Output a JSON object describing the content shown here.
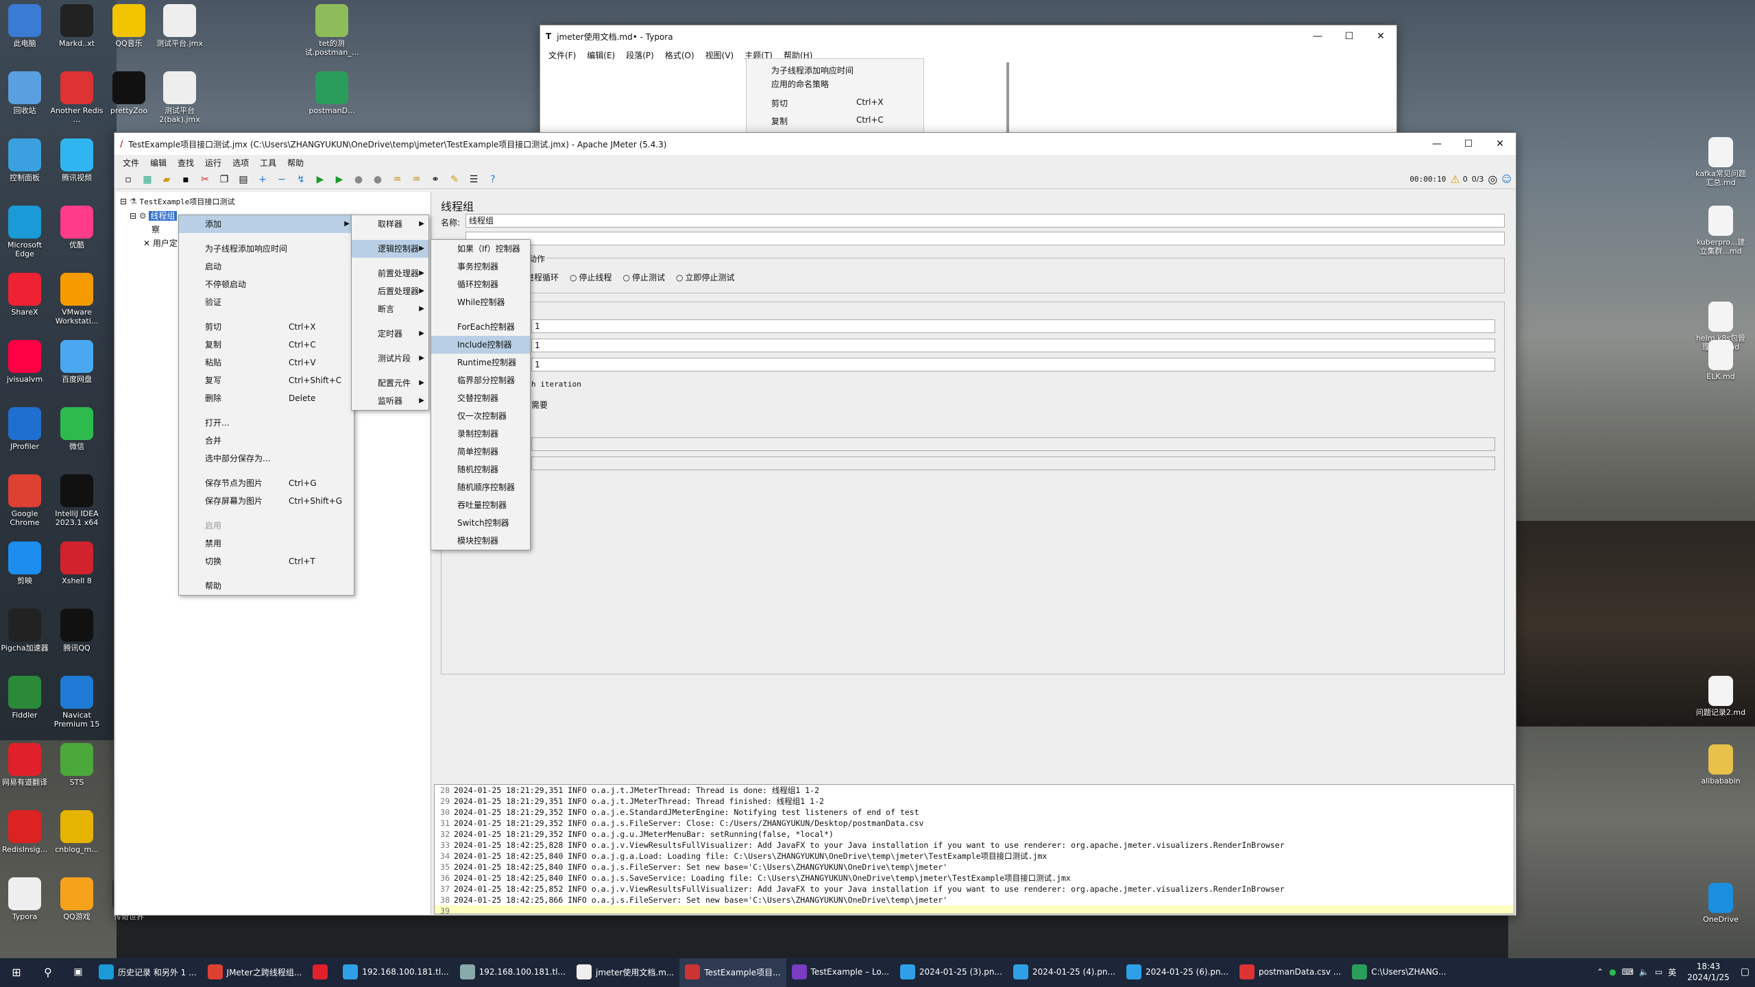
{
  "desktop_icons": [
    {
      "label": "此电脑",
      "color": "#3a7bd5"
    },
    {
      "label": "Markd..xt",
      "color": "#222"
    },
    {
      "label": "QQ音乐",
      "color": "#f2c500"
    },
    {
      "label": "测试平台.jmx",
      "color": "#eee"
    },
    {
      "label": "tet的测试.postman_...",
      "color": "#8fbc5a"
    },
    {
      "label": "回收站",
      "color": "#5aa0e0"
    },
    {
      "label": "Another Redis ...",
      "color": "#d33"
    },
    {
      "label": "prettyZoo",
      "color": "#111"
    },
    {
      "label": "测试平台 2(bak).jmx",
      "color": "#eee"
    },
    {
      "label": "postmanD...",
      "color": "#2a9d5a"
    },
    {
      "label": "控制面板",
      "color": "#3aa0e0"
    },
    {
      "label": "腾讯视频",
      "color": "#2fb6f0"
    },
    {
      "label": "Microsoft Edge",
      "color": "#1a9bd7"
    },
    {
      "label": "优酷",
      "color": "#ff3b8a"
    },
    {
      "label": "ShareX",
      "color": "#e23"
    },
    {
      "label": "VMware Workstati...",
      "color": "#f59b00"
    },
    {
      "label": "jvisualvm",
      "color": "#f04"
    },
    {
      "label": "百度网盘",
      "color": "#4aa8f0"
    },
    {
      "label": "JProfiler",
      "color": "#1f6fd0"
    },
    {
      "label": "微信",
      "color": "#2dbb4e"
    },
    {
      "label": "Google Chrome",
      "color": "#de4032"
    },
    {
      "label": "IntelliJ IDEA 2023.1 x64",
      "color": "#111"
    },
    {
      "label": "剪映",
      "color": "#1b8ef0"
    },
    {
      "label": "Xshell 8",
      "color": "#d2222d"
    },
    {
      "label": "Pigcha加速器",
      "color": "#222"
    },
    {
      "label": "腾讯QQ",
      "color": "#111"
    },
    {
      "label": "Fiddler",
      "color": "#2a8a3a"
    },
    {
      "label": "Navicat Premium 15",
      "color": "#1f7bd5"
    },
    {
      "label": "网易有道翻译",
      "color": "#e0202a"
    },
    {
      "label": "STS",
      "color": "#4ba83a"
    },
    {
      "label": "RedisInsig...",
      "color": "#d22"
    },
    {
      "label": "cnblog_m...",
      "color": "#e5b400"
    },
    {
      "label": "Typora",
      "color": "#eee"
    },
    {
      "label": "QQ游戏",
      "color": "#f7a21b"
    },
    {
      "label": "传奇世界",
      "color": "#333"
    }
  ],
  "right_icons": [
    {
      "label": "kafka常见问题汇总.md"
    },
    {
      "label": "kuberpro...建立集群...md"
    },
    {
      "label": "helm k8s包管理工具.md"
    },
    {
      "label": "ELK.md"
    },
    {
      "label": "问题记录2.md"
    },
    {
      "label": "alibababin"
    },
    {
      "label": "OneDrive"
    }
  ],
  "typora": {
    "title": "jmeter使用文档.md• - Typora",
    "menus": [
      "文件(F)",
      "编辑(E)",
      "段落(P)",
      "格式(O)",
      "视图(V)",
      "主题(T)",
      "帮助(H)"
    ],
    "peek_items": [
      "为子线程添加响应时间",
      "应用的命名策略",
      "剪切",
      "复制"
    ],
    "peek_shortcuts": [
      "",
      "",
      "Ctrl+X",
      "Ctrl+C"
    ]
  },
  "jmeter": {
    "title": "TestExample项目接口测试.jmx (C:\\Users\\ZHANGYUKUN\\OneDrive\\temp\\jmeter\\TestExample项目接口测试.jmx) - Apache JMeter (5.4.3)",
    "menus": [
      "文件",
      "编辑",
      "查找",
      "运行",
      "选项",
      "工具",
      "帮助"
    ],
    "timer": "00:00:10",
    "warn_count": "0",
    "threads": "0/3",
    "tree": {
      "root": "TestExample项目接口测试",
      "thread_group": "线程组",
      "child1": "察",
      "child2": "用户定"
    },
    "panel": {
      "heading": "线程组",
      "name_label": "名称:",
      "name_value": "线程组",
      "action_label": "的动作",
      "radios": [
        "进程循环",
        "停止线程",
        "停止测试",
        "立即停止测试"
      ],
      "values": [
        "1",
        "1",
        "1"
      ],
      "iteration_text": "h iteration",
      "needed_text": "需要"
    },
    "log": [
      {
        "n": "28",
        "t": "2024-01-25 18:21:29,351 INFO o.a.j.t.JMeterThread: Thread is done: 线程组1 1-2"
      },
      {
        "n": "29",
        "t": "2024-01-25 18:21:29,351 INFO o.a.j.t.JMeterThread: Thread finished: 线程组1 1-2"
      },
      {
        "n": "30",
        "t": "2024-01-25 18:21:29,352 INFO o.a.j.e.StandardJMeterEngine: Notifying test listeners of end of test"
      },
      {
        "n": "31",
        "t": "2024-01-25 18:21:29,352 INFO o.a.j.s.FileServer: Close: C:/Users/ZHANGYUKUN/Desktop/postmanData.csv"
      },
      {
        "n": "32",
        "t": "2024-01-25 18:21:29,352 INFO o.a.j.g.u.JMeterMenuBar: setRunning(false, *local*)"
      },
      {
        "n": "33",
        "t": "2024-01-25 18:42:25,828 INFO o.a.j.v.ViewResultsFullVisualizer: Add JavaFX to your Java installation if you want to use renderer: org.apache.jmeter.visualizers.RenderInBrowser"
      },
      {
        "n": "34",
        "t": "2024-01-25 18:42:25,840 INFO o.a.j.g.a.Load: Loading file: C:\\Users\\ZHANGYUKUN\\OneDrive\\temp\\jmeter\\TestExample项目接口测试.jmx"
      },
      {
        "n": "35",
        "t": "2024-01-25 18:42:25,840 INFO o.a.j.s.FileServer: Set new base='C:\\Users\\ZHANGYUKUN\\OneDrive\\temp\\jmeter'"
      },
      {
        "n": "36",
        "t": "2024-01-25 18:42:25,840 INFO o.a.j.s.SaveService: Loading file: C:\\Users\\ZHANGYUKUN\\OneDrive\\temp\\jmeter\\TestExample项目接口测试.jmx"
      },
      {
        "n": "37",
        "t": "2024-01-25 18:42:25,852 INFO o.a.j.v.ViewResultsFullVisualizer: Add JavaFX to your Java installation if you want to use renderer: org.apache.jmeter.visualizers.RenderInBrowser"
      },
      {
        "n": "38",
        "t": "2024-01-25 18:42:25,866 INFO o.a.j.s.FileServer: Set new base='C:\\Users\\ZHANGYUKUN\\OneDrive\\temp\\jmeter'"
      },
      {
        "n": "39",
        "t": ""
      }
    ]
  },
  "context_menu": [
    {
      "label": "添加",
      "shortcut": "",
      "submenu": true,
      "highlight": true
    },
    {
      "sep": true
    },
    {
      "label": "为子线程添加响应时间",
      "shortcut": ""
    },
    {
      "label": "启动",
      "shortcut": ""
    },
    {
      "label": "不停顿启动",
      "shortcut": ""
    },
    {
      "label": "验证",
      "shortcut": ""
    },
    {
      "sep": true
    },
    {
      "label": "剪切",
      "shortcut": "Ctrl+X"
    },
    {
      "label": "复制",
      "shortcut": "Ctrl+C"
    },
    {
      "label": "粘贴",
      "shortcut": "Ctrl+V"
    },
    {
      "label": "复写",
      "shortcut": "Ctrl+Shift+C"
    },
    {
      "label": "删除",
      "shortcut": "Delete"
    },
    {
      "sep": true
    },
    {
      "label": "打开...",
      "shortcut": ""
    },
    {
      "label": "合并",
      "shortcut": ""
    },
    {
      "label": "选中部分保存为...",
      "shortcut": ""
    },
    {
      "sep": true
    },
    {
      "label": "保存节点为图片",
      "shortcut": "Ctrl+G"
    },
    {
      "label": "保存屏幕为图片",
      "shortcut": "Ctrl+Shift+G"
    },
    {
      "sep": true
    },
    {
      "label": "启用",
      "shortcut": "",
      "disabled": true
    },
    {
      "label": "禁用",
      "shortcut": ""
    },
    {
      "label": "切换",
      "shortcut": "Ctrl+T"
    },
    {
      "sep": true
    },
    {
      "label": "帮助",
      "shortcut": ""
    }
  ],
  "add_menu": [
    {
      "label": "取样器",
      "submenu": true
    },
    {
      "sep": true
    },
    {
      "label": "逻辑控制器",
      "submenu": true,
      "highlight": true
    },
    {
      "sep": true
    },
    {
      "label": "前置处理器",
      "submenu": true
    },
    {
      "label": "后置处理器",
      "submenu": true
    },
    {
      "label": "断言",
      "submenu": true
    },
    {
      "sep": true
    },
    {
      "label": "定时器",
      "submenu": true
    },
    {
      "sep": true
    },
    {
      "label": "测试片段",
      "submenu": true
    },
    {
      "sep": true
    },
    {
      "label": "配置元件",
      "submenu": true
    },
    {
      "label": "监听器",
      "submenu": true
    }
  ],
  "logic_menu": [
    {
      "label": "如果（If）控制器"
    },
    {
      "label": "事务控制器"
    },
    {
      "label": "循环控制器"
    },
    {
      "label": "While控制器"
    },
    {
      "sep": true
    },
    {
      "label": "ForEach控制器"
    },
    {
      "label": "Include控制器",
      "highlight": true
    },
    {
      "label": "Runtime控制器"
    },
    {
      "label": "临界部分控制器"
    },
    {
      "label": "交替控制器"
    },
    {
      "label": "仅一次控制器"
    },
    {
      "label": "录制控制器"
    },
    {
      "label": "简单控制器"
    },
    {
      "label": "随机控制器"
    },
    {
      "label": "随机顺序控制器"
    },
    {
      "label": "吞吐量控制器"
    },
    {
      "label": "Switch控制器"
    },
    {
      "label": "模块控制器"
    }
  ],
  "taskbar": {
    "items": [
      {
        "label": "历史记录 和另外 1 ...",
        "color": "#1a9bd7"
      },
      {
        "label": "JMeter之跨线程组...",
        "color": "#de4032"
      },
      {
        "label": "",
        "color": "#e0202a"
      },
      {
        "label": "192.168.100.181.tl...",
        "color": "#2fa0e8"
      },
      {
        "label": "192.168.100.181.tl...",
        "color": "#8aa"
      },
      {
        "label": "jmeter使用文档.m...",
        "color": "#eee"
      },
      {
        "label": "TestExample项目...",
        "color": "#c33"
      },
      {
        "label": "TestExample – Lo...",
        "color": "#7a3cc0"
      },
      {
        "label": "2024-01-25 (3).pn...",
        "color": "#2fa0e8"
      },
      {
        "label": "2024-01-25 (4).pn...",
        "color": "#2fa0e8"
      },
      {
        "label": "2024-01-25 (6).pn...",
        "color": "#2fa0e8"
      },
      {
        "label": "postmanData.csv ...",
        "color": "#d33"
      },
      {
        "label": "C:\\Users\\ZHANG...",
        "color": "#2a9d5a"
      }
    ],
    "lang": "英",
    "time": "18:43",
    "date": "2024/1/25"
  }
}
